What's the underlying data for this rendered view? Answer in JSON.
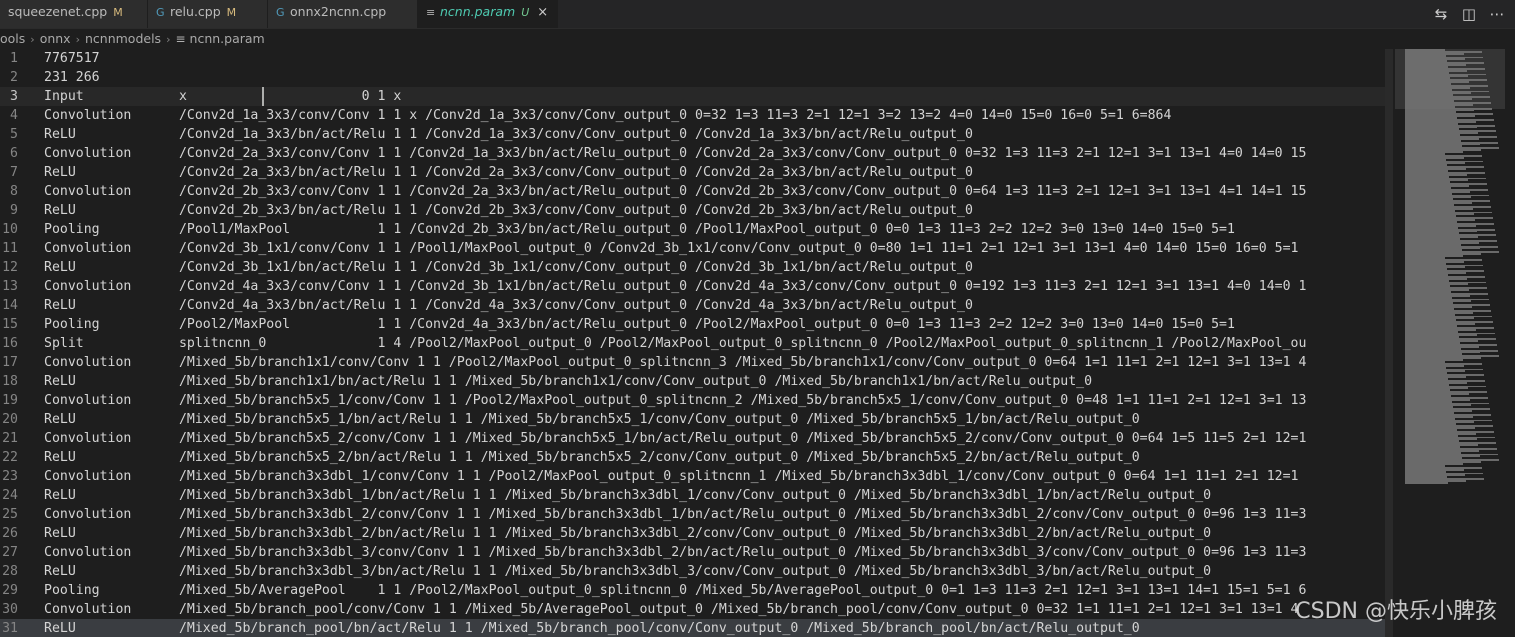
{
  "tabs": [
    {
      "label": "squeezenet.cpp",
      "status": "M",
      "active": false
    },
    {
      "label": "relu.cpp",
      "status": "M",
      "active": false
    },
    {
      "label": "onnx2ncnn.cpp",
      "status": "",
      "active": false
    },
    {
      "label": "ncnn.param",
      "status": "U",
      "active": true
    }
  ],
  "tab_close_glyph": "×",
  "breadcrumb": [
    "ools",
    "onnx",
    "ncnnmodels",
    "ncnn.param"
  ],
  "lines": [
    "7767517",
    "231 266",
    "Input            x                      0 1 x",
    "Convolution      /Conv2d_1a_3x3/conv/Conv 1 1 x /Conv2d_1a_3x3/conv/Conv_output_0 0=32 1=3 11=3 2=1 12=1 3=2 13=2 4=0 14=0 15=0 16=0 5=1 6=864",
    "ReLU             /Conv2d_1a_3x3/bn/act/Relu 1 1 /Conv2d_1a_3x3/conv/Conv_output_0 /Conv2d_1a_3x3/bn/act/Relu_output_0",
    "Convolution      /Conv2d_2a_3x3/conv/Conv 1 1 /Conv2d_1a_3x3/bn/act/Relu_output_0 /Conv2d_2a_3x3/conv/Conv_output_0 0=32 1=3 11=3 2=1 12=1 3=1 13=1 4=0 14=0 15",
    "ReLU             /Conv2d_2a_3x3/bn/act/Relu 1 1 /Conv2d_2a_3x3/conv/Conv_output_0 /Conv2d_2a_3x3/bn/act/Relu_output_0",
    "Convolution      /Conv2d_2b_3x3/conv/Conv 1 1 /Conv2d_2a_3x3/bn/act/Relu_output_0 /Conv2d_2b_3x3/conv/Conv_output_0 0=64 1=3 11=3 2=1 12=1 3=1 13=1 4=1 14=1 15",
    "ReLU             /Conv2d_2b_3x3/bn/act/Relu 1 1 /Conv2d_2b_3x3/conv/Conv_output_0 /Conv2d_2b_3x3/bn/act/Relu_output_0",
    "Pooling          /Pool1/MaxPool           1 1 /Conv2d_2b_3x3/bn/act/Relu_output_0 /Pool1/MaxPool_output_0 0=0 1=3 11=3 2=2 12=2 3=0 13=0 14=0 15=0 5=1",
    "Convolution      /Conv2d_3b_1x1/conv/Conv 1 1 /Pool1/MaxPool_output_0 /Conv2d_3b_1x1/conv/Conv_output_0 0=80 1=1 11=1 2=1 12=1 3=1 13=1 4=0 14=0 15=0 16=0 5=1",
    "ReLU             /Conv2d_3b_1x1/bn/act/Relu 1 1 /Conv2d_3b_1x1/conv/Conv_output_0 /Conv2d_3b_1x1/bn/act/Relu_output_0",
    "Convolution      /Conv2d_4a_3x3/conv/Conv 1 1 /Conv2d_3b_1x1/bn/act/Relu_output_0 /Conv2d_4a_3x3/conv/Conv_output_0 0=192 1=3 11=3 2=1 12=1 3=1 13=1 4=0 14=0 1",
    "ReLU             /Conv2d_4a_3x3/bn/act/Relu 1 1 /Conv2d_4a_3x3/conv/Conv_output_0 /Conv2d_4a_3x3/bn/act/Relu_output_0",
    "Pooling          /Pool2/MaxPool           1 1 /Conv2d_4a_3x3/bn/act/Relu_output_0 /Pool2/MaxPool_output_0 0=0 1=3 11=3 2=2 12=2 3=0 13=0 14=0 15=0 5=1",
    "Split            splitncnn_0              1 4 /Pool2/MaxPool_output_0 /Pool2/MaxPool_output_0_splitncnn_0 /Pool2/MaxPool_output_0_splitncnn_1 /Pool2/MaxPool_ou",
    "Convolution      /Mixed_5b/branch1x1/conv/Conv 1 1 /Pool2/MaxPool_output_0_splitncnn_3 /Mixed_5b/branch1x1/conv/Conv_output_0 0=64 1=1 11=1 2=1 12=1 3=1 13=1 4",
    "ReLU             /Mixed_5b/branch1x1/bn/act/Relu 1 1 /Mixed_5b/branch1x1/conv/Conv_output_0 /Mixed_5b/branch1x1/bn/act/Relu_output_0",
    "Convolution      /Mixed_5b/branch5x5_1/conv/Conv 1 1 /Pool2/MaxPool_output_0_splitncnn_2 /Mixed_5b/branch5x5_1/conv/Conv_output_0 0=48 1=1 11=1 2=1 12=1 3=1 13",
    "ReLU             /Mixed_5b/branch5x5_1/bn/act/Relu 1 1 /Mixed_5b/branch5x5_1/conv/Conv_output_0 /Mixed_5b/branch5x5_1/bn/act/Relu_output_0",
    "Convolution      /Mixed_5b/branch5x5_2/conv/Conv 1 1 /Mixed_5b/branch5x5_1/bn/act/Relu_output_0 /Mixed_5b/branch5x5_2/conv/Conv_output_0 0=64 1=5 11=5 2=1 12=1",
    "ReLU             /Mixed_5b/branch5x5_2/bn/act/Relu 1 1 /Mixed_5b/branch5x5_2/conv/Conv_output_0 /Mixed_5b/branch5x5_2/bn/act/Relu_output_0",
    "Convolution      /Mixed_5b/branch3x3dbl_1/conv/Conv 1 1 /Pool2/MaxPool_output_0_splitncnn_1 /Mixed_5b/branch3x3dbl_1/conv/Conv_output_0 0=64 1=1 11=1 2=1 12=1",
    "ReLU             /Mixed_5b/branch3x3dbl_1/bn/act/Relu 1 1 /Mixed_5b/branch3x3dbl_1/conv/Conv_output_0 /Mixed_5b/branch3x3dbl_1/bn/act/Relu_output_0",
    "Convolution      /Mixed_5b/branch3x3dbl_2/conv/Conv 1 1 /Mixed_5b/branch3x3dbl_1/bn/act/Relu_output_0 /Mixed_5b/branch3x3dbl_2/conv/Conv_output_0 0=96 1=3 11=3",
    "ReLU             /Mixed_5b/branch3x3dbl_2/bn/act/Relu 1 1 /Mixed_5b/branch3x3dbl_2/conv/Conv_output_0 /Mixed_5b/branch3x3dbl_2/bn/act/Relu_output_0",
    "Convolution      /Mixed_5b/branch3x3dbl_3/conv/Conv 1 1 /Mixed_5b/branch3x3dbl_2/bn/act/Relu_output_0 /Mixed_5b/branch3x3dbl_3/conv/Conv_output_0 0=96 1=3 11=3",
    "ReLU             /Mixed_5b/branch3x3dbl_3/bn/act/Relu 1 1 /Mixed_5b/branch3x3dbl_3/conv/Conv_output_0 /Mixed_5b/branch3x3dbl_3/bn/act/Relu_output_0",
    "Pooling          /Mixed_5b/AveragePool    1 1 /Pool2/MaxPool_output_0_splitncnn_0 /Mixed_5b/AveragePool_output_0 0=1 1=3 11=3 2=1 12=1 3=1 13=1 14=1 15=1 5=1 6",
    "Convolution      /Mixed_5b/branch_pool/conv/Conv 1 1 /Mixed_5b/AveragePool_output_0 /Mixed_5b/branch_pool/conv/Conv_output_0 0=32 1=1 11=1 2=1 12=1 3=1 13=1 4",
    "ReLU             /Mixed_5b/branch_pool/bn/act/Relu 1 1 /Mixed_5b/branch_pool/conv/Conv_output_0 /Mixed_5b/branch_pool/bn/act/Relu_output_0"
  ],
  "current_line": 3,
  "watermark": "CSDN @快乐小脾孩",
  "icons": [
    "source-control-icon",
    "split-editor-icon",
    "more-actions-icon",
    "file-lines-icon"
  ],
  "colors": {
    "accent_active_tab": "#4ec9b0",
    "modified": "#d7ba7d",
    "untracked": "#73c991",
    "editor_bg": "#1e1e1e"
  }
}
